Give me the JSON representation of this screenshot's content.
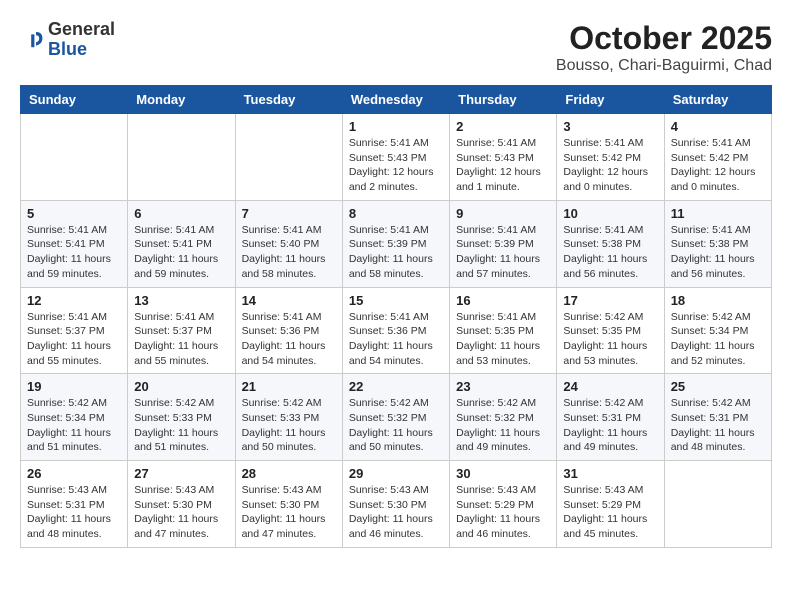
{
  "header": {
    "logo_general": "General",
    "logo_blue": "Blue",
    "month_title": "October 2025",
    "location": "Bousso, Chari-Baguirmi, Chad"
  },
  "weekdays": [
    "Sunday",
    "Monday",
    "Tuesday",
    "Wednesday",
    "Thursday",
    "Friday",
    "Saturday"
  ],
  "weeks": [
    [
      {
        "day": "",
        "info": ""
      },
      {
        "day": "",
        "info": ""
      },
      {
        "day": "",
        "info": ""
      },
      {
        "day": "1",
        "info": "Sunrise: 5:41 AM\nSunset: 5:43 PM\nDaylight: 12 hours\nand 2 minutes."
      },
      {
        "day": "2",
        "info": "Sunrise: 5:41 AM\nSunset: 5:43 PM\nDaylight: 12 hours\nand 1 minute."
      },
      {
        "day": "3",
        "info": "Sunrise: 5:41 AM\nSunset: 5:42 PM\nDaylight: 12 hours\nand 0 minutes."
      },
      {
        "day": "4",
        "info": "Sunrise: 5:41 AM\nSunset: 5:42 PM\nDaylight: 12 hours\nand 0 minutes."
      }
    ],
    [
      {
        "day": "5",
        "info": "Sunrise: 5:41 AM\nSunset: 5:41 PM\nDaylight: 11 hours\nand 59 minutes."
      },
      {
        "day": "6",
        "info": "Sunrise: 5:41 AM\nSunset: 5:41 PM\nDaylight: 11 hours\nand 59 minutes."
      },
      {
        "day": "7",
        "info": "Sunrise: 5:41 AM\nSunset: 5:40 PM\nDaylight: 11 hours\nand 58 minutes."
      },
      {
        "day": "8",
        "info": "Sunrise: 5:41 AM\nSunset: 5:39 PM\nDaylight: 11 hours\nand 58 minutes."
      },
      {
        "day": "9",
        "info": "Sunrise: 5:41 AM\nSunset: 5:39 PM\nDaylight: 11 hours\nand 57 minutes."
      },
      {
        "day": "10",
        "info": "Sunrise: 5:41 AM\nSunset: 5:38 PM\nDaylight: 11 hours\nand 56 minutes."
      },
      {
        "day": "11",
        "info": "Sunrise: 5:41 AM\nSunset: 5:38 PM\nDaylight: 11 hours\nand 56 minutes."
      }
    ],
    [
      {
        "day": "12",
        "info": "Sunrise: 5:41 AM\nSunset: 5:37 PM\nDaylight: 11 hours\nand 55 minutes."
      },
      {
        "day": "13",
        "info": "Sunrise: 5:41 AM\nSunset: 5:37 PM\nDaylight: 11 hours\nand 55 minutes."
      },
      {
        "day": "14",
        "info": "Sunrise: 5:41 AM\nSunset: 5:36 PM\nDaylight: 11 hours\nand 54 minutes."
      },
      {
        "day": "15",
        "info": "Sunrise: 5:41 AM\nSunset: 5:36 PM\nDaylight: 11 hours\nand 54 minutes."
      },
      {
        "day": "16",
        "info": "Sunrise: 5:41 AM\nSunset: 5:35 PM\nDaylight: 11 hours\nand 53 minutes."
      },
      {
        "day": "17",
        "info": "Sunrise: 5:42 AM\nSunset: 5:35 PM\nDaylight: 11 hours\nand 53 minutes."
      },
      {
        "day": "18",
        "info": "Sunrise: 5:42 AM\nSunset: 5:34 PM\nDaylight: 11 hours\nand 52 minutes."
      }
    ],
    [
      {
        "day": "19",
        "info": "Sunrise: 5:42 AM\nSunset: 5:34 PM\nDaylight: 11 hours\nand 51 minutes."
      },
      {
        "day": "20",
        "info": "Sunrise: 5:42 AM\nSunset: 5:33 PM\nDaylight: 11 hours\nand 51 minutes."
      },
      {
        "day": "21",
        "info": "Sunrise: 5:42 AM\nSunset: 5:33 PM\nDaylight: 11 hours\nand 50 minutes."
      },
      {
        "day": "22",
        "info": "Sunrise: 5:42 AM\nSunset: 5:32 PM\nDaylight: 11 hours\nand 50 minutes."
      },
      {
        "day": "23",
        "info": "Sunrise: 5:42 AM\nSunset: 5:32 PM\nDaylight: 11 hours\nand 49 minutes."
      },
      {
        "day": "24",
        "info": "Sunrise: 5:42 AM\nSunset: 5:31 PM\nDaylight: 11 hours\nand 49 minutes."
      },
      {
        "day": "25",
        "info": "Sunrise: 5:42 AM\nSunset: 5:31 PM\nDaylight: 11 hours\nand 48 minutes."
      }
    ],
    [
      {
        "day": "26",
        "info": "Sunrise: 5:43 AM\nSunset: 5:31 PM\nDaylight: 11 hours\nand 48 minutes."
      },
      {
        "day": "27",
        "info": "Sunrise: 5:43 AM\nSunset: 5:30 PM\nDaylight: 11 hours\nand 47 minutes."
      },
      {
        "day": "28",
        "info": "Sunrise: 5:43 AM\nSunset: 5:30 PM\nDaylight: 11 hours\nand 47 minutes."
      },
      {
        "day": "29",
        "info": "Sunrise: 5:43 AM\nSunset: 5:30 PM\nDaylight: 11 hours\nand 46 minutes."
      },
      {
        "day": "30",
        "info": "Sunrise: 5:43 AM\nSunset: 5:29 PM\nDaylight: 11 hours\nand 46 minutes."
      },
      {
        "day": "31",
        "info": "Sunrise: 5:43 AM\nSunset: 5:29 PM\nDaylight: 11 hours\nand 45 minutes."
      },
      {
        "day": "",
        "info": ""
      }
    ]
  ]
}
